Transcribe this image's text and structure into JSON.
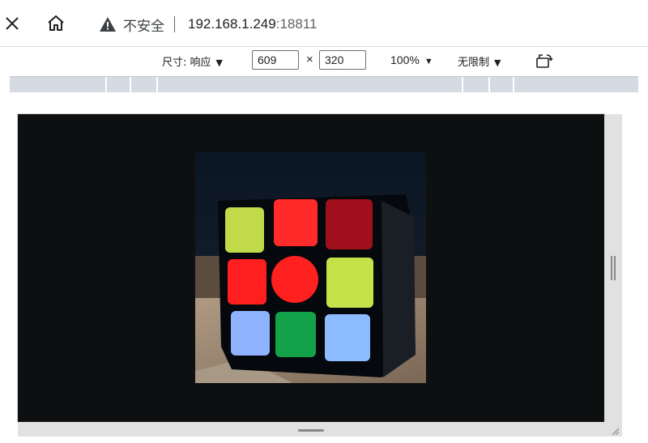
{
  "browser": {
    "close_icon": "close-icon",
    "home_icon": "home-icon",
    "security_icon": "warning-triangle-icon",
    "security_label": "不安全",
    "url_host": "192.168.1.249",
    "url_port": ":18811"
  },
  "device_toolbar": {
    "dimensions_label": "尺寸: 响应",
    "width_value": "609",
    "times_symbol": "×",
    "height_value": "320",
    "zoom_label": "100%",
    "throttle_label": "无限制",
    "caret_glyph": "▼",
    "rotate_icon": "rotate-device-icon"
  },
  "viewport": {
    "content": "rubiks-cube-camera-image",
    "cube_colors": {
      "top_row": [
        "#c2d94a",
        "#ff2b2b",
        "#a0101c"
      ],
      "middle_row": [
        "#ff1f1f",
        "#ff2020",
        "#c6e04a"
      ],
      "bottom_row": [
        "#8fb2ff",
        "#13a14a",
        "#8dbbff"
      ]
    }
  }
}
